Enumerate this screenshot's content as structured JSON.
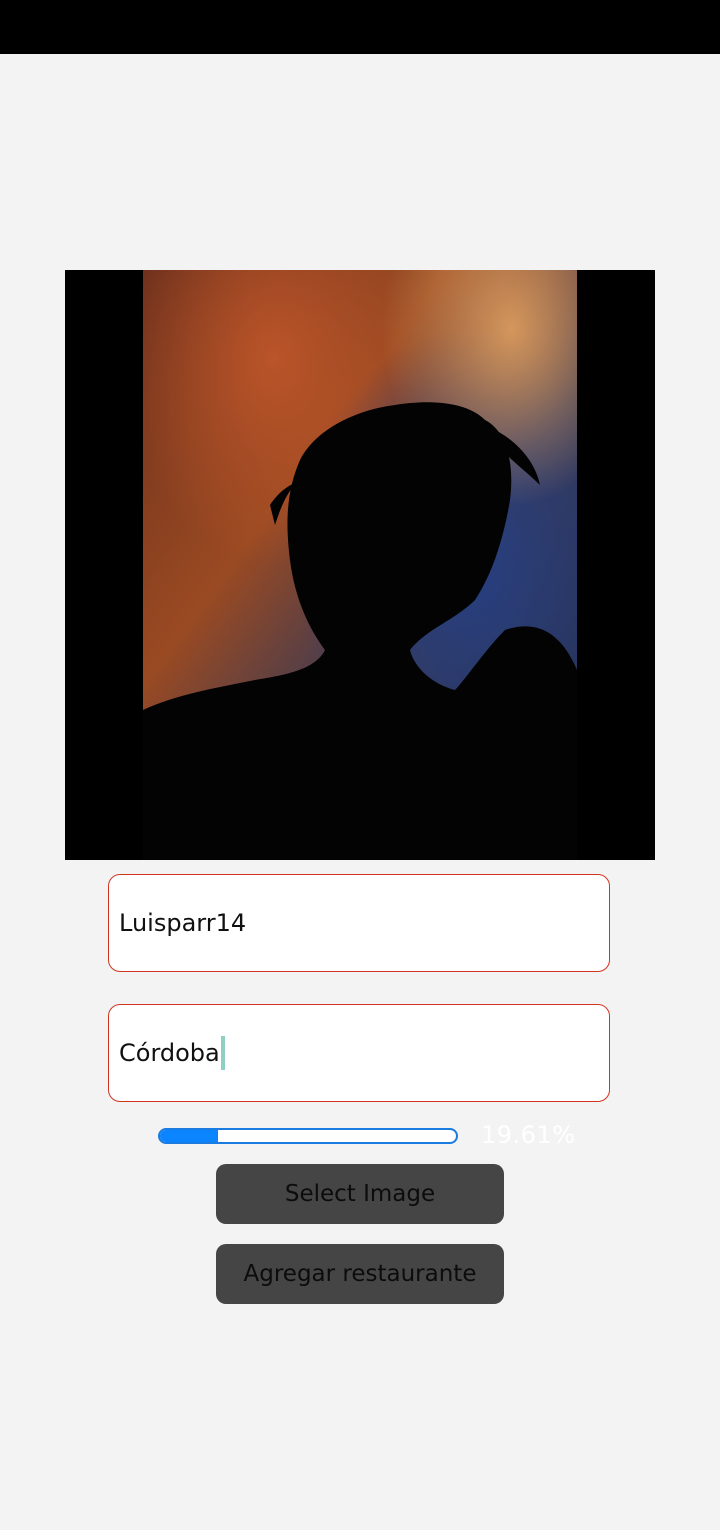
{
  "form": {
    "username_value": "Luisparr14",
    "city_value": "Córdoba"
  },
  "upload": {
    "progress_percent": 19.61,
    "progress_label": "19.61%"
  },
  "buttons": {
    "select_image_label": "Select Image",
    "add_restaurant_label": "Agregar restaurante"
  },
  "colors": {
    "field_border": "#d2341f",
    "progress_accent": "#0a84ff",
    "button_bg": "#454545",
    "page_bg": "#f3f3f3"
  }
}
